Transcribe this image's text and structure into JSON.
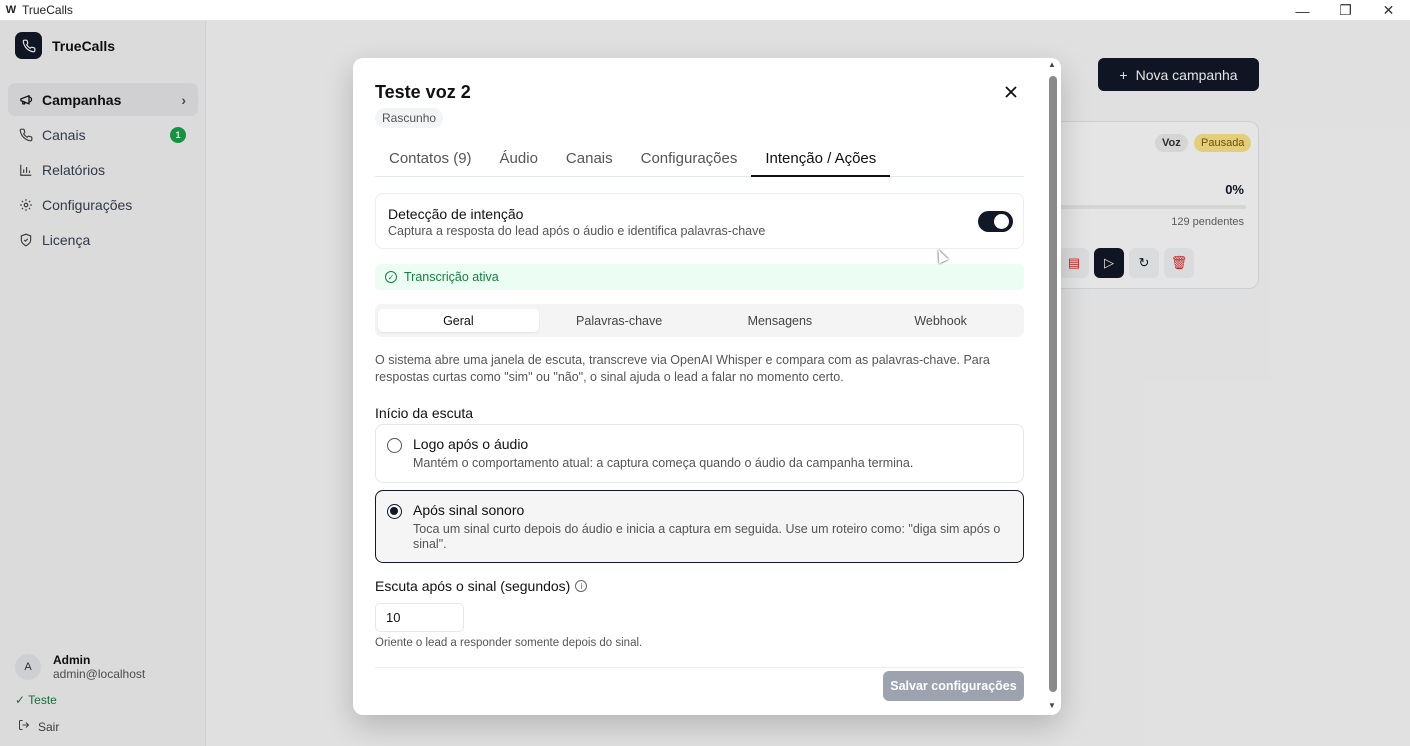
{
  "window": {
    "logo_letter": "W",
    "title": "TrueCalls",
    "minimize": "—",
    "restore": "❐",
    "close": "✕"
  },
  "sidebar": {
    "brand": "TrueCalls",
    "items": [
      {
        "label": "Campanhas",
        "icon": "megaphone-icon",
        "active": true
      },
      {
        "label": "Canais",
        "icon": "phone-icon",
        "badge": "1"
      },
      {
        "label": "Relatórios",
        "icon": "bar-chart-icon"
      },
      {
        "label": "Configurações",
        "icon": "gear-icon"
      },
      {
        "label": "Licença",
        "icon": "shield-check-icon"
      }
    ],
    "user": {
      "initial": "A",
      "name": "Admin",
      "email": "admin@localhost"
    },
    "tenant": "✓ Teste",
    "logout": "Sair"
  },
  "main": {
    "new_campaign": "Nova campanha",
    "card": {
      "tag_type": "Voz",
      "tag_status": "Pausada",
      "progress_pct": "0%",
      "pending": "129 pendentes"
    }
  },
  "modal": {
    "title": "Teste voz 2",
    "status": "Rascunho",
    "tabs": [
      {
        "label": "Contatos (9)"
      },
      {
        "label": "Áudio"
      },
      {
        "label": "Canais"
      },
      {
        "label": "Configurações"
      },
      {
        "label": "Intenção / Ações",
        "active": true
      }
    ],
    "detect": {
      "title": "Detecção de intenção",
      "subtitle": "Captura a resposta do lead após o áudio e identifica palavras-chave",
      "enabled": true
    },
    "transcription": "Transcrição ativa",
    "subtabs": [
      {
        "label": "Geral",
        "active": true
      },
      {
        "label": "Palavras-chave"
      },
      {
        "label": "Mensagens"
      },
      {
        "label": "Webhook"
      }
    ],
    "description": "O sistema abre uma janela de escuta, transcreve via OpenAI Whisper e compara com as palavras-chave. Para respostas curtas como \"sim\" ou \"não\", o sinal ajuda o lead a falar no momento certo.",
    "start_label": "Início da escuta",
    "options": [
      {
        "title": "Logo após o áudio",
        "subtitle": "Mantém o comportamento atual: a captura começa quando o áudio da campanha termina.",
        "checked": false
      },
      {
        "title": "Após sinal sonoro",
        "subtitle": "Toca um sinal curto depois do áudio e inicia a captura em seguida. Use um roteiro como: \"diga sim após o sinal\".",
        "checked": true
      }
    ],
    "listen_label": "Escuta após o sinal (segundos)",
    "listen_value": "10",
    "hint": "Oriente o lead a responder somente depois do sinal.",
    "save": "Salvar configurações"
  }
}
